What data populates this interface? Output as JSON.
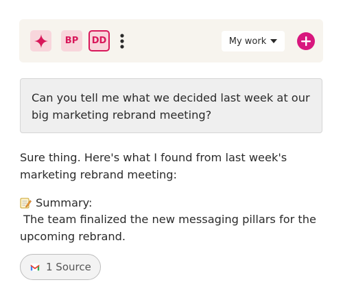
{
  "toolbar": {
    "avatars": [
      {
        "initials": "BP"
      },
      {
        "initials": "DD"
      }
    ],
    "view_select": {
      "value": "My work"
    },
    "icons": {
      "sparkle": "sparkle-icon",
      "more": "vertical-ellipsis-icon",
      "caret": "caret-down-icon",
      "add": "plus-icon"
    },
    "accent_color": "#d8175a",
    "add_color": "#d8177e"
  },
  "conversation": {
    "question": "Can you tell me what we decided last week at our big marketing rebrand meeting?",
    "answer_intro": "Sure thing. Here's what I found from last week's marketing rebrand meeting:",
    "summary_label": "Summary:",
    "summary_text": "The team finalized the new messaging pillars for the upcoming rebrand.",
    "source_button": "1 Source",
    "icons": {
      "summary": "memo-icon",
      "source": "gmail-icon"
    }
  }
}
